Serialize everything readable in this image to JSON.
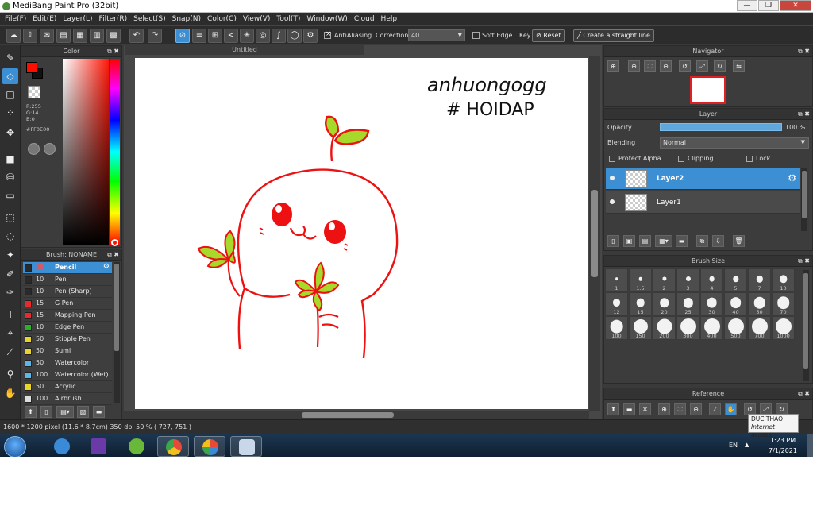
{
  "window": {
    "title": "MediBang Paint Pro (32bit)",
    "controls": [
      "—",
      "❐",
      "✕"
    ]
  },
  "menu": [
    "File(F)",
    "Edit(E)",
    "Layer(L)",
    "Filter(R)",
    "Select(S)",
    "Snap(N)",
    "Color(C)",
    "View(V)",
    "Tool(T)",
    "Window(W)",
    "Cloud",
    "Help"
  ],
  "toolbar": {
    "antialiasing_label": "AntiAliasing",
    "antialiasing_checked": true,
    "correction_label": "Correction",
    "correction_value": "40",
    "soft_edge_label": "Soft Edge",
    "soft_edge_checked": false,
    "key_label": "Key",
    "reset_label": "Reset",
    "straight_line_label": "Create a straight line"
  },
  "color_panel": {
    "title": "Color",
    "r": "R:255",
    "g": "G:14",
    "b": "B:0",
    "hex": "#FF0E00",
    "foreground": "#ff0e00"
  },
  "brush_panel": {
    "title": "Brush: NONAME",
    "brushes": [
      {
        "size": "25",
        "name": "Pencil",
        "color": "#2a2a2a",
        "selected": true
      },
      {
        "size": "10",
        "name": "Pen",
        "color": "#2a2a2a"
      },
      {
        "size": "10",
        "name": "Pen (Sharp)",
        "color": "#2a2a2a"
      },
      {
        "size": "15",
        "name": "G Pen",
        "color": "#e82a2a"
      },
      {
        "size": "15",
        "name": "Mapping Pen",
        "color": "#e82a2a"
      },
      {
        "size": "10",
        "name": "Edge Pen",
        "color": "#2ab02a"
      },
      {
        "size": "50",
        "name": "Stipple Pen",
        "color": "#e8d42a"
      },
      {
        "size": "50",
        "name": "Sumi",
        "color": "#e8d42a"
      },
      {
        "size": "50",
        "name": "Watercolor",
        "color": "#5ab8e8"
      },
      {
        "size": "100",
        "name": "Watercolor (Wet)",
        "color": "#5ab8e8"
      },
      {
        "size": "50",
        "name": "Acrylic",
        "color": "#e8d42a"
      },
      {
        "size": "100",
        "name": "Airbrush",
        "color": "#dddddd"
      }
    ]
  },
  "canvas": {
    "tab_title": "Untitled",
    "handwriting_line1": "anhuongogg",
    "handwriting_line2": "# HOIDAP"
  },
  "navigator": {
    "title": "Navigator"
  },
  "layer_panel": {
    "title": "Layer",
    "opacity_label": "Opacity",
    "opacity_value": "100 %",
    "opacity_fraction": 1.0,
    "blending_label": "Blending",
    "blending_value": "Normal",
    "protect_alpha_label": "Protect Alpha",
    "clipping_label": "Clipping",
    "lock_label": "Lock",
    "layers": [
      {
        "name": "Layer2",
        "selected": true
      },
      {
        "name": "Layer1",
        "selected": false
      }
    ]
  },
  "brush_size_panel": {
    "title": "Brush Size",
    "sizes": [
      "1",
      "1.5",
      "2",
      "3",
      "4",
      "5",
      "7",
      "10",
      "12",
      "15",
      "20",
      "25",
      "30",
      "40",
      "50",
      "70",
      "100",
      "150",
      "200",
      "300",
      "400",
      "500",
      "700",
      "1000"
    ]
  },
  "reference_panel": {
    "title": "Reference"
  },
  "status": {
    "text": "1600 * 1200 pixel   (11.6 * 8.7cm)   350 dpi   50 %   ( 727, 751 )"
  },
  "tooltip": {
    "line1": "DUC THAO",
    "line2": "Internet access"
  },
  "taskbar": {
    "lang": "EN",
    "time": "1:23 PM",
    "date": "7/1/2021"
  },
  "colors": {
    "accent": "#3d8fd4",
    "drawing_red": "#ee1111",
    "leaf_green": "#a6d92a"
  }
}
